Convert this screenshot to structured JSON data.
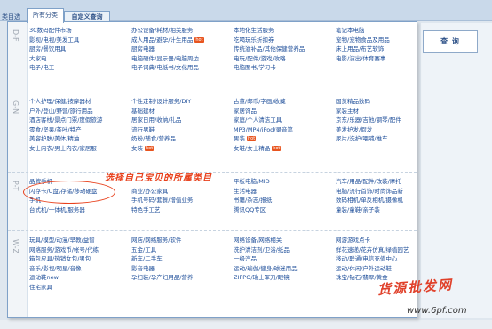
{
  "header": {
    "page_label": "类目选",
    "tab_all": "所有分类",
    "tab_custom": "自定义查询"
  },
  "search_button": "查 询",
  "groups": [
    {
      "letter": "D-F",
      "cols": [
        [
          "3C数码配件市场",
          "影视/电视/美发工具",
          "厨房/餐饮用具",
          "大家电",
          "电子/电工"
        ],
        [
          "办公设备/耗材/相关服务",
          "成人用品/避孕/计生用品",
          "厨房电器",
          "电脑硬件/显示器/电脑周边",
          "电子词典/电纸书/文化用品"
        ],
        [
          "本地化生活服务",
          "吃喝玩乐折扣券",
          "传统滋补品/其他保健营养品",
          "电玩/配件/游戏/攻略",
          "电脑图书/学习卡"
        ],
        [
          "笔记本电脑",
          "宠物/宠物食品及用品",
          "床上用品/布艺软饰",
          "电影/演出/体育赛事",
          ""
        ]
      ],
      "hot": [
        [
          1,
          1
        ]
      ]
    },
    {
      "letter": "G-N",
      "cols": [
        [
          "个人护理/保健/按摩器材",
          "户外/登山/野营/旅行用品",
          "酒店客栈/景点门票/度假旅游",
          "零食/坚果/茶叶/特产",
          "美容护肤/美体/精油",
          "女士内衣/男士内衣/家居服"
        ],
        [
          "个性定制/设计服务/DIY",
          "基础建材",
          "居家日用/收纳/礼品",
          "流行男鞋",
          "奶粉/辅食/营养品",
          "女装"
        ],
        [
          "古董/邮币/字画/收藏",
          "家居饰品",
          "家庭/个人清洁工具",
          "MP3/MP4/iPod/录音笔",
          "男装",
          "女鞋/女士精品"
        ],
        [
          "国货精品数码",
          "家装主材",
          "京东/乐器/吉他/钢琴/配件",
          "美发护发/假发",
          "尿片/洗护/喂哺/推车",
          ""
        ]
      ],
      "hot": [
        [
          1,
          5
        ],
        [
          2,
          4
        ],
        [
          2,
          5
        ]
      ]
    },
    {
      "letter": "P-T",
      "cols": [
        [
          "品牌手机",
          "闪存卡/U盘/存储/移动硬盘",
          "手机",
          "台式机/一体机/服务器"
        ],
        [
          "",
          "商业/办公家具",
          "手机号码/套餐/增值业务",
          "特色手工艺"
        ],
        [
          "平板电脑/MID",
          "生活电器",
          "书籍/杂志/报纸",
          "腾讯QQ专区"
        ],
        [
          "汽车/用品/配件/改装/摩托",
          "电脑/流行首饰/时尚饰品新",
          "数码相机/单反相机/摄像机",
          "童装/童鞋/亲子装"
        ]
      ],
      "hot": []
    },
    {
      "letter": "W-Z",
      "cols": [
        [
          "玩具/模型/动漫/早教/益智",
          "网络服务/游戏币/帐号/代练",
          "箱包皮具/热销女包/男包",
          "音乐/影视/明星/音像",
          "运动鞋new",
          "住宅家具"
        ],
        [
          "网店/网络服务/软件",
          "五金/工具",
          "新车/二手车",
          "影音电器",
          "孕妇装/孕产妇用品/营养",
          ""
        ],
        [
          "网络设备/网络相关",
          "洗护清洁剂/卫浴/纸品",
          "一级汽品",
          "运动/瑜伽/健身/球迷用品",
          "ZIPPO/瑞士军刀/眼镜",
          ""
        ],
        [
          "网游游戏点卡",
          "鲜花速递/花卉仿真/绿植园艺",
          "移动/联通/电信充值中心",
          "运动/休闲/户外运动鞋",
          "珠宝/钻石/翡翠/黄金",
          ""
        ]
      ],
      "hot": []
    }
  ],
  "annotation": "选择自己宝贝的所属类目",
  "watermark": {
    "brand": "货源批发网",
    "url": "www.6pf.com"
  }
}
